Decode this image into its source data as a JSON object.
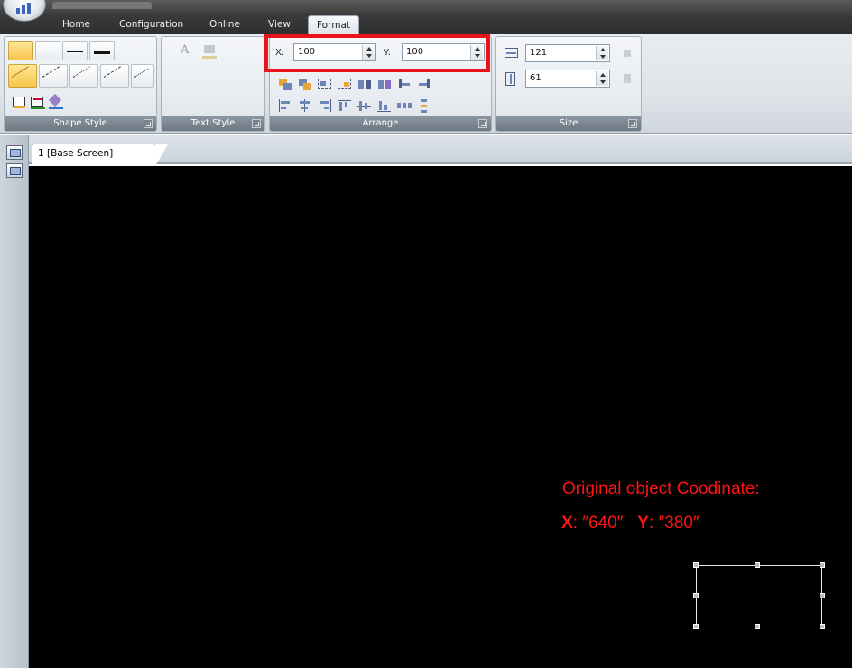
{
  "menu": {
    "tabs": [
      {
        "label": "Home"
      },
      {
        "label": "Configuration"
      },
      {
        "label": "Online"
      },
      {
        "label": "View"
      },
      {
        "label": "Format",
        "active": true
      }
    ]
  },
  "ribbon": {
    "groups": {
      "shape_style": {
        "label": "Shape Style"
      },
      "text_style": {
        "label": "Text Style"
      },
      "arrange": {
        "label": "Arrange"
      },
      "size": {
        "label": "Size"
      }
    },
    "position": {
      "x_label": "X:",
      "x_value": "100",
      "y_label": "Y:",
      "y_value": "100"
    },
    "size": {
      "width_value": "121",
      "height_value": "61"
    },
    "highlight_color": "#e8141b"
  },
  "document": {
    "tab_label": "1 [Base Screen]"
  },
  "annotation": {
    "title": "Original object Coodinate:",
    "x_label": "X",
    "x_value": ": ″640″",
    "y_label": "Y",
    "y_value": ": ″380″",
    "color": "#ff1414"
  },
  "icons": [
    "app-orb-icon",
    "line-style-icon",
    "fill-color-icon",
    "line-color-icon",
    "shadow-icon",
    "text-color-icon",
    "align-icon",
    "order-icon",
    "width-icon",
    "height-icon",
    "screen-list-icon"
  ]
}
